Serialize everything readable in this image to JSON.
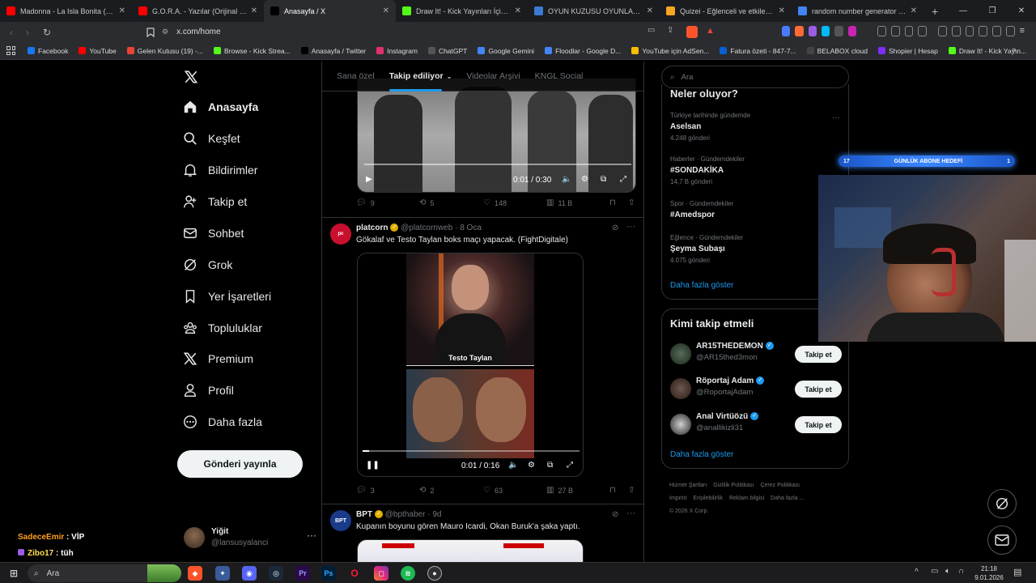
{
  "browser": {
    "tabs": [
      {
        "title": "Madonna - La Isla Bonita (Official Vi",
        "icon": "youtube-icon",
        "color": "#ff0000"
      },
      {
        "title": "G.O.R.A. - Yazılar (Orijinal Film M",
        "icon": "youtube-audio-icon",
        "color": "#ff0000"
      },
      {
        "title": "Anasayfa / X",
        "icon": "x-logo-icon",
        "color": "#000000",
        "active": true
      },
      {
        "title": "Draw It! - Kick Yayınları İçin Çizim",
        "icon": "pencil-icon",
        "color": "#53fc18"
      },
      {
        "title": "OYUN KUZUSU OYUNLAR ++",
        "icon": "game-icon",
        "color": "#3a7bd5"
      },
      {
        "title": "Quizei - Eğlenceli ve etkileşimli quiz",
        "icon": "quiz-icon",
        "color": "#f5a623"
      },
      {
        "title": "random number generator - Google",
        "icon": "google-icon",
        "color": "#4285f4"
      }
    ],
    "url": "x.com/home",
    "bookmarks": [
      {
        "label": "Facebook",
        "color": "#1877f2"
      },
      {
        "label": "YouTube",
        "color": "#ff0000"
      },
      {
        "label": "Gelen Kutusu (19) -...",
        "color": "#ea4335"
      },
      {
        "label": "Browse - Kick Strea...",
        "color": "#53fc18"
      },
      {
        "label": "Anasayfa / Twitter",
        "color": "#000000"
      },
      {
        "label": "Instagram",
        "color": "#e1306c"
      },
      {
        "label": "ChatGPT",
        "color": "#555555"
      },
      {
        "label": "Google Gemini",
        "color": "#4285f4"
      },
      {
        "label": "Floodlar - Google D...",
        "color": "#4285f4"
      },
      {
        "label": "YouTube için AdSen...",
        "color": "#fbbc04"
      },
      {
        "label": "Fatura özeti - 847-7...",
        "color": "#0a5fd1"
      },
      {
        "label": "BELABOX cloud",
        "color": "#444444"
      },
      {
        "label": "Shopier | Hesap",
        "color": "#7b2ff7"
      },
      {
        "label": "Draw It! - Kick Yayın...",
        "color": "#53fc18"
      }
    ]
  },
  "nav": {
    "items": [
      {
        "label": "Anasayfa",
        "icon": "home-icon"
      },
      {
        "label": "Keşfet",
        "icon": "search-icon"
      },
      {
        "label": "Bildirimler",
        "icon": "bell-icon"
      },
      {
        "label": "Takip et",
        "icon": "person-add-icon"
      },
      {
        "label": "Sohbet",
        "icon": "mail-icon"
      },
      {
        "label": "Grok",
        "icon": "grok-icon"
      },
      {
        "label": "Yer İşaretleri",
        "icon": "bookmark-icon"
      },
      {
        "label": "Topluluklar",
        "icon": "communities-icon"
      },
      {
        "label": "Premium",
        "icon": "x-premium-icon"
      },
      {
        "label": "Profil",
        "icon": "profile-icon"
      },
      {
        "label": "Daha fazla",
        "icon": "more-circle-icon"
      }
    ],
    "post_button": "Gönderi yayınla",
    "account": {
      "name": "Yiğit",
      "handle": "@lansusyalanci"
    }
  },
  "feed": {
    "tabs": [
      "Sana özel",
      "Takip ediliyor",
      "Videolar Arşivi",
      "KNGL Social"
    ],
    "tweets": [
      {
        "video_time": "0:01 / 0:30",
        "replies": "9",
        "retweets": "5",
        "likes": "148",
        "views": "11 B"
      },
      {
        "name": "platcorn",
        "handle": "@platcornweb",
        "date": "8 Oca",
        "text": "Gökalaf ve Testo Taylan boks maçı yapacak. (FightDigitale)",
        "video_caption": "Testo Taylan",
        "video_time": "0:01 / 0:16",
        "replies": "3",
        "retweets": "2",
        "likes": "63",
        "views": "27 B"
      },
      {
        "name": "BPT",
        "handle": "@bpthaber",
        "date": "9d",
        "text": "Kupanın boyunu gören Mauro Icardi, Okan Buruk'a şaka yaptı."
      }
    ]
  },
  "right": {
    "search_placeholder": "Ara",
    "trends_title": "Neler oluyor?",
    "trends": [
      {
        "context": "Türkiye tarihinde gündemde",
        "name": "Aselsan",
        "count": "4.248 gönderi"
      },
      {
        "context": "Haberler · Gündemdekiler",
        "name": "#SONDAKİKA",
        "count": "14,7 B gönderi"
      },
      {
        "context": "Spor · Gündemdekiler",
        "name": "#Amedspor",
        "count": ""
      },
      {
        "context": "Eğlence · Gündemdekiler",
        "name": "Şeyma Subaşı",
        "count": "4.075 gönderi"
      }
    ],
    "show_more": "Daha fazla göster",
    "wtf_title": "Kimi takip etmeli",
    "who_to_follow": [
      {
        "name": "AR15THEDEMON",
        "handle": "@AR15thed3mon",
        "button": "Takip et"
      },
      {
        "name": "Röportaj Adam",
        "handle": "@RoportajAdam",
        "button": "Takip et"
      },
      {
        "name": "Anal Virtüözü",
        "handle": "@anallikizli31",
        "button": "Takip et"
      }
    ],
    "wtf_more": "Daha fazla göster",
    "footer": [
      "Hizmet Şartları",
      "Gizlilik Politikası",
      "Çerez Politikası",
      "Imprint",
      "Erişilebilirlik",
      "Reklam bilgisi",
      "Daha fazla ...",
      "© 2026 X Corp."
    ]
  },
  "overlay": {
    "goal_left": "17",
    "goal_label": "GÜNLÜK ABONE HEDEFİ",
    "goal_right": "1",
    "chat": [
      {
        "user": "SadeceEmir",
        "text": "VİP",
        "color": "#ff9f1c"
      },
      {
        "user": "Zibo17",
        "text": "tüh",
        "color": "#ffe14d"
      }
    ]
  },
  "taskbar": {
    "search": "Ara",
    "time": "21:18",
    "date": "9.01.2026",
    "apps": [
      "Brave",
      "Apps",
      "Discord",
      "Steam",
      "Premiere",
      "Photoshop",
      "Opera",
      "Instagram",
      "Spotify",
      "OBS"
    ]
  }
}
